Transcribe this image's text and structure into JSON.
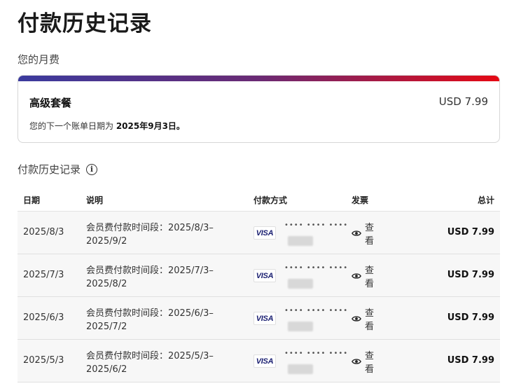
{
  "page_title": "付款历史记录",
  "monthly_fee_label": "您的月费",
  "plan": {
    "name": "高级套餐",
    "price": "USD 7.99",
    "next_bill_prefix": "您的下一个账单日期为 ",
    "next_bill_date": "2025年9月3日。"
  },
  "history_label": "付款历史记录",
  "info_glyph": "i",
  "table": {
    "headers": {
      "date": "日期",
      "desc": "说明",
      "method": "付款方式",
      "invoice": "发票",
      "total": "总计"
    },
    "rows": [
      {
        "date": "2025/8/3",
        "desc": "会员费付款时间段：2025/8/3–2025/9/2",
        "card_brand": "VISA",
        "card_mask": "•••• •••• ••••",
        "invoice": "查看",
        "total": "USD 7.99"
      },
      {
        "date": "2025/7/3",
        "desc": "会员费付款时间段：2025/7/3–2025/8/2",
        "card_brand": "VISA",
        "card_mask": "•••• •••• ••••",
        "invoice": "查看",
        "total": "USD 7.99"
      },
      {
        "date": "2025/6/3",
        "desc": "会员费付款时间段：2025/6/3–2025/7/2",
        "card_brand": "VISA",
        "card_mask": "•••• •••• ••••",
        "invoice": "查看",
        "total": "USD 7.99"
      },
      {
        "date": "2025/5/3",
        "desc": "会员费付款时间段：2025/5/3–2025/6/2",
        "card_brand": "VISA",
        "card_mask": "•••• •••• ••••",
        "invoice": "查看",
        "total": "USD 7.99"
      }
    ]
  },
  "colors": {
    "gradient_start": "#3b3b9e",
    "gradient_end": "#e50914",
    "visa_blue": "#1a1f71"
  }
}
